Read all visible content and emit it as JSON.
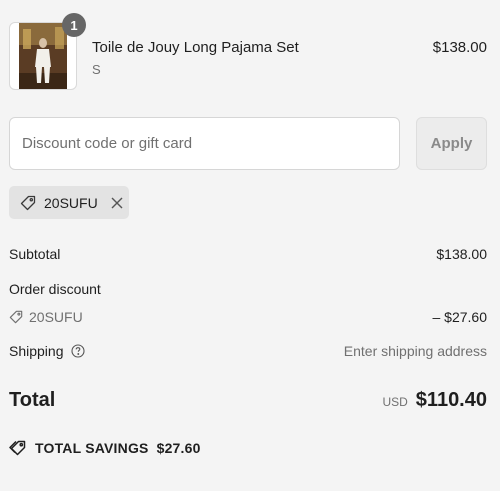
{
  "line_item": {
    "quantity": "1",
    "name": "Toile de Jouy Long Pajama Set",
    "variant": "S",
    "price": "$138.00"
  },
  "discount_form": {
    "placeholder": "Discount code or gift card",
    "apply_label": "Apply"
  },
  "applied_code": {
    "code": "20SUFU"
  },
  "summary": {
    "subtotal_label": "Subtotal",
    "subtotal_value": "$138.00",
    "order_discount_label": "Order discount",
    "discount_code": "20SUFU",
    "discount_value": "– $27.60",
    "shipping_label": "Shipping",
    "shipping_value": "Enter shipping address",
    "total_label": "Total",
    "total_currency": "USD",
    "total_value": "$110.40",
    "savings_label": "TOTAL SAVINGS",
    "savings_value": "$27.60"
  },
  "colors": {
    "background": "#f4f4f4",
    "badge": "#666666",
    "muted_text": "#707070",
    "chip": "#e3e3e3"
  }
}
